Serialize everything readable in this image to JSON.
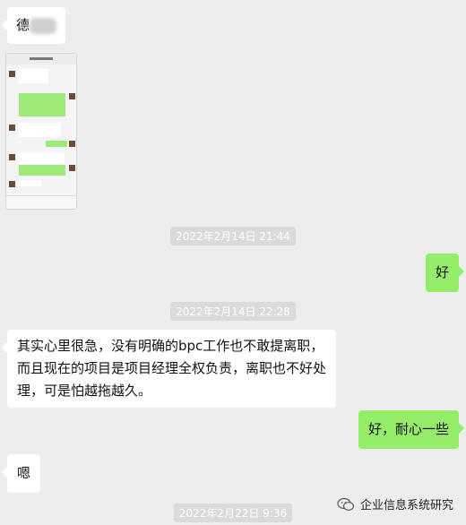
{
  "messages": {
    "m1": "德",
    "ts1": "2022年2月14日 21:44",
    "m2": "好",
    "ts2": "2022年2月14日 22:28",
    "m3_line1": "其实心里很急，没有明确的bpc工作也不敢提离职，",
    "m3_line2": "而且现在的项目是项目经理全权负责，离职也不好处",
    "m3_line3": "理，可是怕越拖越久。",
    "m4": "好，耐心一些",
    "m5": "嗯",
    "ts3": "2022年2月22日 9:36"
  },
  "watermark": {
    "text": "企业信息系统研究",
    "icon": "wechat-icon"
  },
  "colors": {
    "background": "#ededed",
    "incoming": "#ffffff",
    "outgoing": "#95ec69"
  }
}
